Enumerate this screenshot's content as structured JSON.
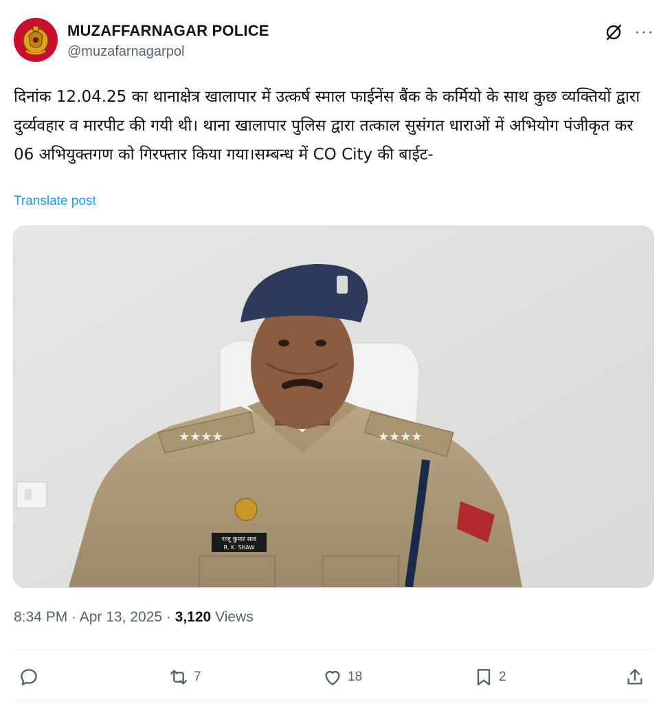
{
  "account": {
    "name": "MUZAFFARNAGAR POLICE",
    "handle": "@muzafarnagarpol",
    "avatar_icon": "up-police-emblem-icon"
  },
  "header_icons": {
    "grok": "grok-icon",
    "more": "···"
  },
  "post": {
    "text": "दिनांक 12.04.25 का थानाक्षेत्र खालापार में उत्कर्ष स्माल फाईनेंस बैंक के कर्मियो के साथ कुछ व्यक्तियों द्वारा दुर्व्यवहार व मारपीट की गयी थी। थाना खालापार पुलिस द्वारा तत्काल सुसंगत धाराओं में अभियोग पंजीकृत कर 06 अभियुक्तगण को गिरफ्तार किया गया।सम्बन्ध में CO City की बाईट-",
    "translate_label": "Translate post"
  },
  "media": {
    "description": "video-frame-police-officer",
    "nameplate_line1": "राजू कुमार साव",
    "nameplate_line2": "R. K. SHAW"
  },
  "meta": {
    "time": "8:34 PM",
    "separator": " · ",
    "date": "Apr 13, 2025",
    "views_count": "3,120",
    "views_label": "Views"
  },
  "actions": {
    "replies": "",
    "reposts": "7",
    "likes": "18",
    "bookmarks": "2"
  },
  "colors": {
    "link": "#1d9bf0",
    "secondary_text": "#536471",
    "primary_text": "#0f1419",
    "avatar_bg": "#c8102e"
  }
}
